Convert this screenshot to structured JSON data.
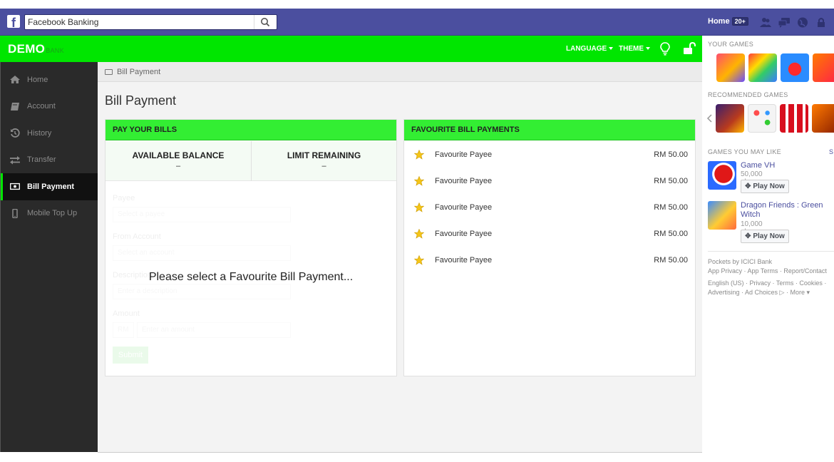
{
  "fb": {
    "search_value": "Facebook Banking",
    "home_label": "Home",
    "home_count": "20+"
  },
  "header": {
    "brand": "DEMO",
    "brand_sub": "BANK",
    "language_label": "LANGUAGE",
    "theme_label": "THEME"
  },
  "sidebar": {
    "items": [
      {
        "label": "Home",
        "icon": "home-icon"
      },
      {
        "label": "Account",
        "icon": "book-icon"
      },
      {
        "label": "History",
        "icon": "history-icon"
      },
      {
        "label": "Transfer",
        "icon": "transfer-icon"
      },
      {
        "label": "Bill Payment",
        "icon": "money-icon",
        "active": true
      },
      {
        "label": "Mobile Top Up",
        "icon": "mobile-icon"
      }
    ]
  },
  "main": {
    "breadcrumb": "Bill Payment",
    "title": "Bill Payment",
    "pay_panel": {
      "heading": "PAY YOUR BILLS",
      "available_balance_label": "AVAILABLE BALANCE",
      "available_balance_value": "–",
      "limit_remaining_label": "LIMIT REMAINING",
      "limit_remaining_value": "–",
      "form": {
        "payee_label": "Payee",
        "payee_placeholder": "Select a payee",
        "from_account_label": "From Account",
        "from_account_placeholder": "Select an account",
        "description_label": "Description",
        "description_placeholder": "Enter a description",
        "amount_label": "Amount",
        "amount_currency": "RM",
        "amount_placeholder": "Enter an amount",
        "submit_label": "Submit"
      },
      "overlay_message": "Please select a Favourite Bill Payment..."
    },
    "fav_panel": {
      "heading": "FAVOURITE BILL PAYMENTS",
      "items": [
        {
          "name": "Favourite Payee",
          "amount": "RM 50.00"
        },
        {
          "name": "Favourite Payee",
          "amount": "RM 50.00"
        },
        {
          "name": "Favourite Payee",
          "amount": "RM 50.00"
        },
        {
          "name": "Favourite Payee",
          "amount": "RM 50.00"
        },
        {
          "name": "Favourite Payee",
          "amount": "RM 50.00"
        }
      ]
    }
  },
  "right": {
    "your_games_heading": "YOUR GAMES",
    "recommended_heading": "RECOMMENDED GAMES",
    "games_like_heading": "GAMES YOU MAY LIKE",
    "see_all": "S",
    "suggested": [
      {
        "title": "Game VH",
        "players": "50,000 players",
        "button": "Play Now"
      },
      {
        "title": "Dragon Friends : Green Witch",
        "players": "10,000 players",
        "button": "Play Now"
      }
    ],
    "footer_line1": "Pockets by ICICI Bank",
    "footer_line2": "App Privacy · App Terms · Report/Contact",
    "footer_line3": "English (US) · Privacy · Terms · Cookies ·",
    "footer_line4": "Advertising · Ad Choices ▷ · More ▾"
  }
}
